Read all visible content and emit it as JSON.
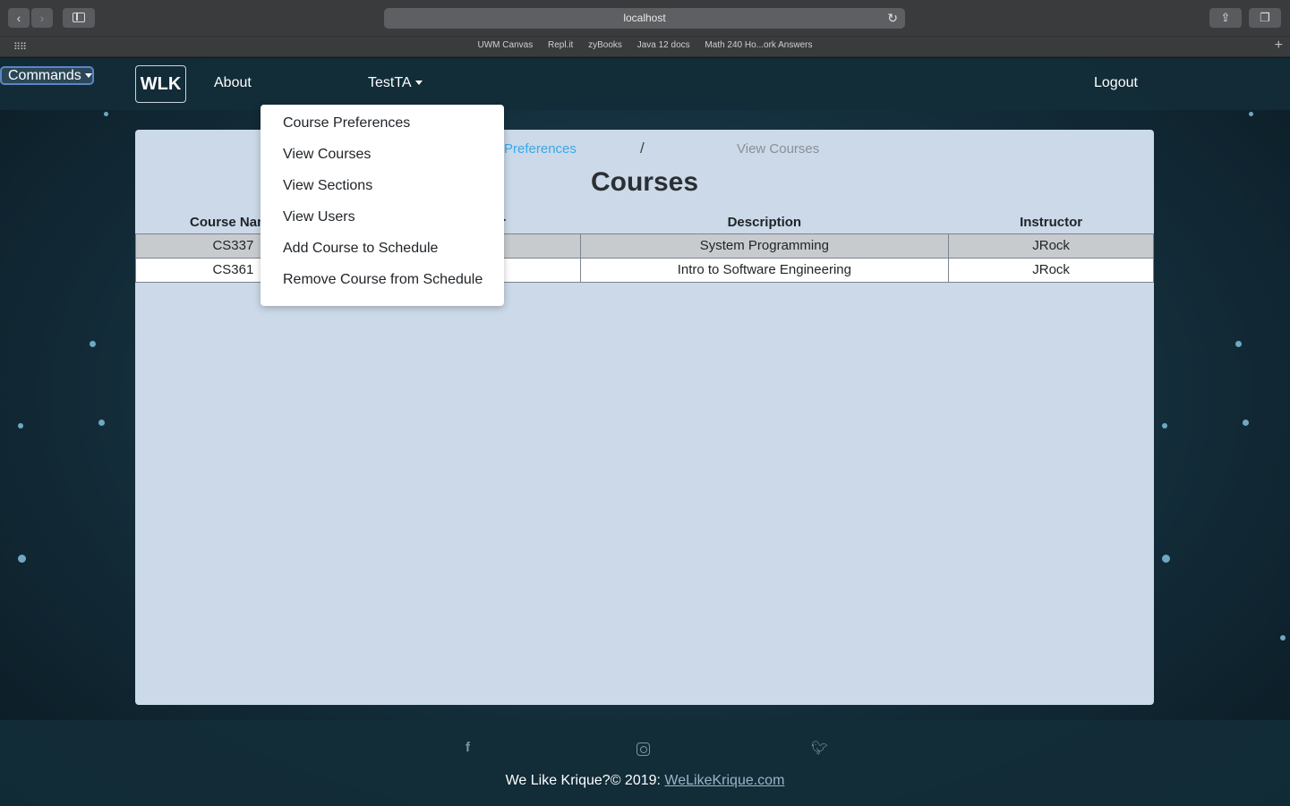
{
  "browser": {
    "url": "localhost",
    "bookmarks": [
      "UWM Canvas",
      "Repl.it",
      "zyBooks",
      "Java 12 docs",
      "Math 240 Ho...ork Answers"
    ]
  },
  "navbar": {
    "brand": "WLK",
    "about": "About",
    "commands": "Commands",
    "user": "TestTA",
    "logout": "Logout"
  },
  "dropdown": {
    "items": [
      "Course Preferences",
      "View Courses",
      "View Sections",
      "View Users",
      "Add Course to Schedule",
      "Remove Course from Schedule"
    ]
  },
  "breadcrumb": {
    "link": "Preferences",
    "separator": "/",
    "current": "View Courses"
  },
  "main": {
    "heading": "Courses",
    "table": {
      "headers": [
        "Course Name",
        "Course Number",
        "Description",
        "Instructor"
      ],
      "rows": [
        [
          "CS337",
          "",
          "System Programming",
          "JRock"
        ],
        [
          "CS361",
          "",
          "Intro to Software Engineering",
          "JRock"
        ]
      ]
    }
  },
  "footer": {
    "copyright_text": "We Like Krique?© 2019: ",
    "link": "WeLikeKrique.com"
  }
}
